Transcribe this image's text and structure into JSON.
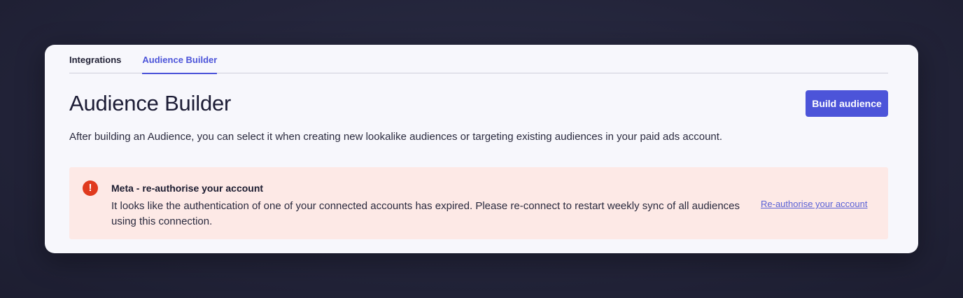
{
  "tabs": [
    {
      "label": "Integrations",
      "active": false
    },
    {
      "label": "Audience Builder",
      "active": true
    }
  ],
  "page": {
    "title": "Audience Builder",
    "description": "After building an Audience, you can select it when creating new lookalike audiences or targeting existing audiences in your paid ads account.",
    "build_button_label": "Build audience"
  },
  "alert": {
    "icon": "exclamation-icon",
    "icon_glyph": "!",
    "title": "Meta - re-authorise your account",
    "body": "It looks like the authentication of one of your connected accounts has expired. Please re-connect to restart weekly sync of all audiences using this connection.",
    "link_label": "Re-authorise your account"
  },
  "colors": {
    "accent": "#4c54d9",
    "alert_background": "#fde9e6",
    "alert_icon": "#e03a1e"
  }
}
